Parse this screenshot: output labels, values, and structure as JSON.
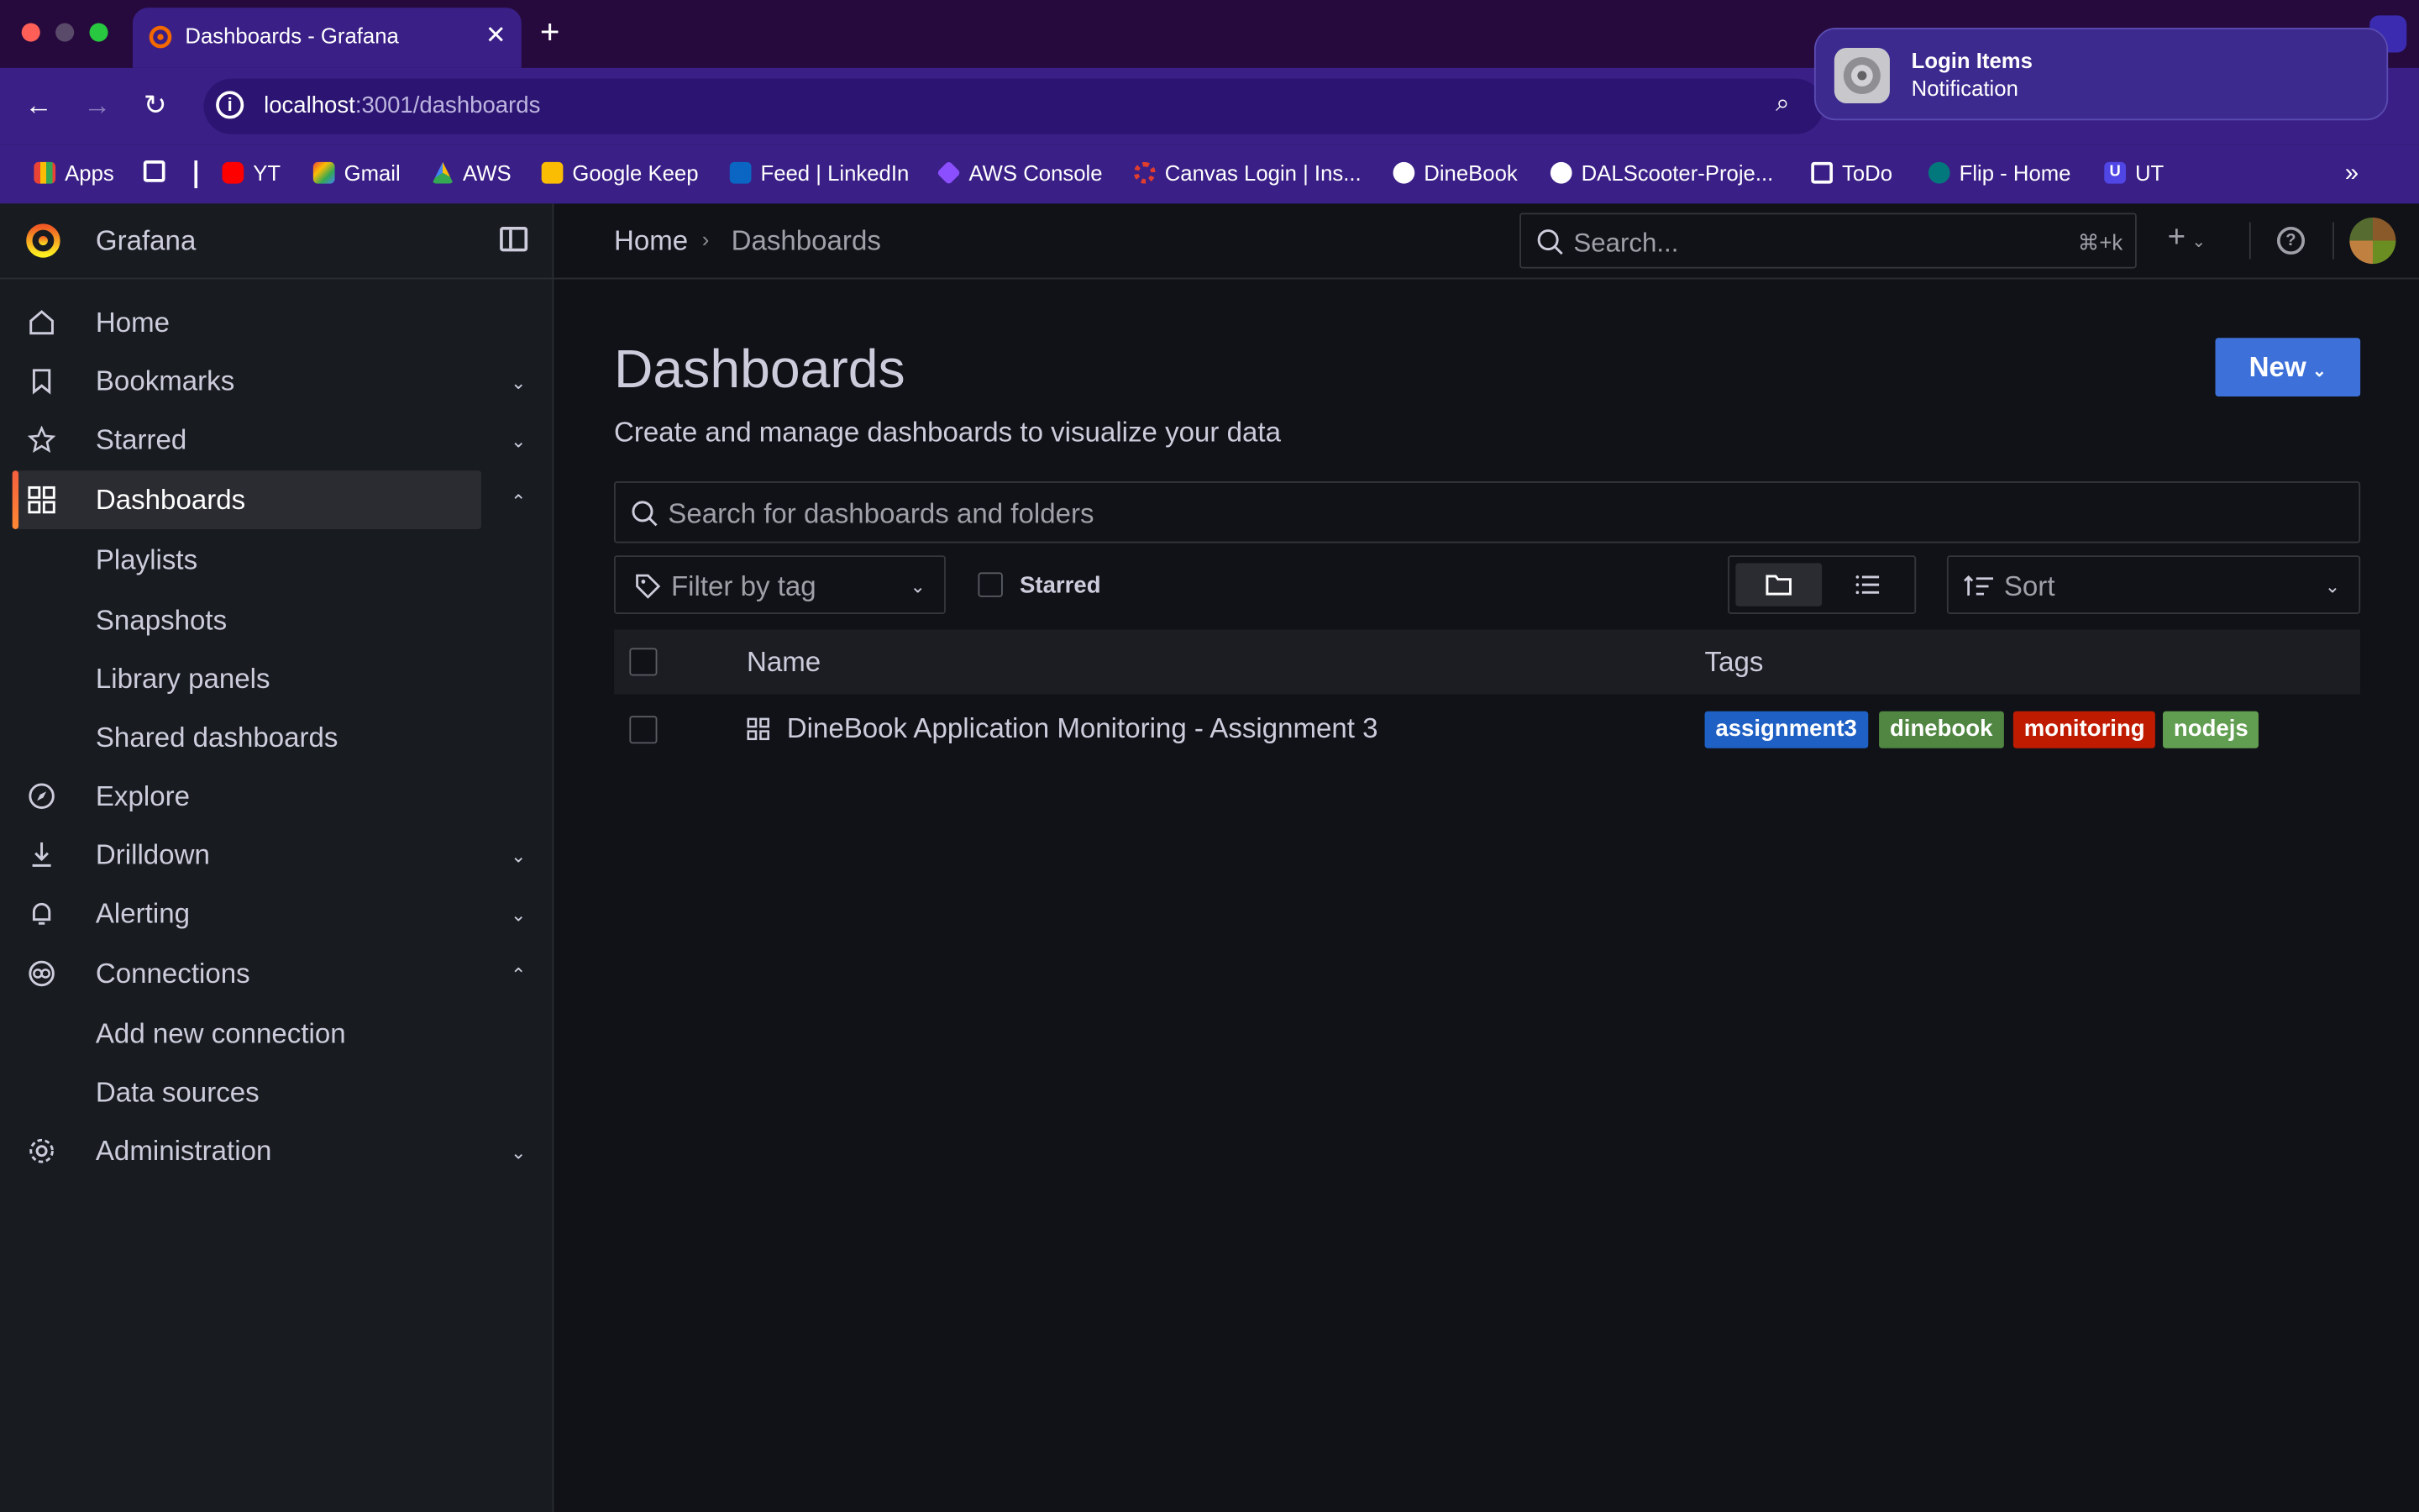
{
  "browser": {
    "tab_title": "Dashboards - Grafana",
    "url_host": "localhost",
    "url_rest": ":3001/dashboards",
    "bookmarks": [
      {
        "label": "Apps",
        "icon": "apps-grid-icon"
      },
      {
        "label": "YT",
        "icon": "youtube-icon"
      },
      {
        "label": "Gmail",
        "icon": "gmail-icon"
      },
      {
        "label": "AWS",
        "icon": "drive-icon"
      },
      {
        "label": "Google Keep",
        "icon": "keep-icon"
      },
      {
        "label": "Feed | LinkedIn",
        "icon": "linkedin-icon"
      },
      {
        "label": "AWS Console",
        "icon": "cube-icon"
      },
      {
        "label": "Canvas Login | Ins...",
        "icon": "canvas-icon"
      },
      {
        "label": "DineBook",
        "icon": "github-icon"
      },
      {
        "label": "DALScooter-Proje...",
        "icon": "github-icon"
      },
      {
        "label": "ToDo",
        "icon": "folder-icon"
      },
      {
        "label": "Flip - Home",
        "icon": "sharepoint-icon"
      },
      {
        "label": "UT",
        "icon": "u-icon"
      }
    ]
  },
  "notification": {
    "title": "Login Items",
    "subtitle": "Notification"
  },
  "grafana": {
    "app_name": "Grafana",
    "nav": {
      "home": "Home",
      "bookmarks": "Bookmarks",
      "starred": "Starred",
      "dashboards": "Dashboards",
      "playlists": "Playlists",
      "snapshots": "Snapshots",
      "library_panels": "Library panels",
      "shared_dashboards": "Shared dashboards",
      "explore": "Explore",
      "drilldown": "Drilldown",
      "alerting": "Alerting",
      "connections": "Connections",
      "add_new_connection": "Add new connection",
      "data_sources": "Data sources",
      "administration": "Administration"
    },
    "breadcrumb": {
      "home": "Home",
      "current": "Dashboards"
    },
    "top_search": {
      "placeholder": "Search...",
      "shortcut": "⌘+k"
    },
    "page": {
      "title": "Dashboards",
      "subtitle": "Create and manage dashboards to visualize your data",
      "new_button": "New",
      "search_placeholder": "Search for dashboards and folders",
      "filter_tag_placeholder": "Filter by tag",
      "starred_label": "Starred",
      "sort_label": "Sort"
    },
    "table": {
      "col_name": "Name",
      "col_tags": "Tags",
      "rows": [
        {
          "name": "DineBook Application Monitoring - Assignment 3",
          "tags": [
            {
              "label": "assignment3",
              "color": "#1f60c4"
            },
            {
              "label": "dinebook",
              "color": "#508642"
            },
            {
              "label": "monitoring",
              "color": "#bf1b00"
            },
            {
              "label": "nodejs",
              "color": "#629e51"
            }
          ]
        }
      ]
    }
  }
}
